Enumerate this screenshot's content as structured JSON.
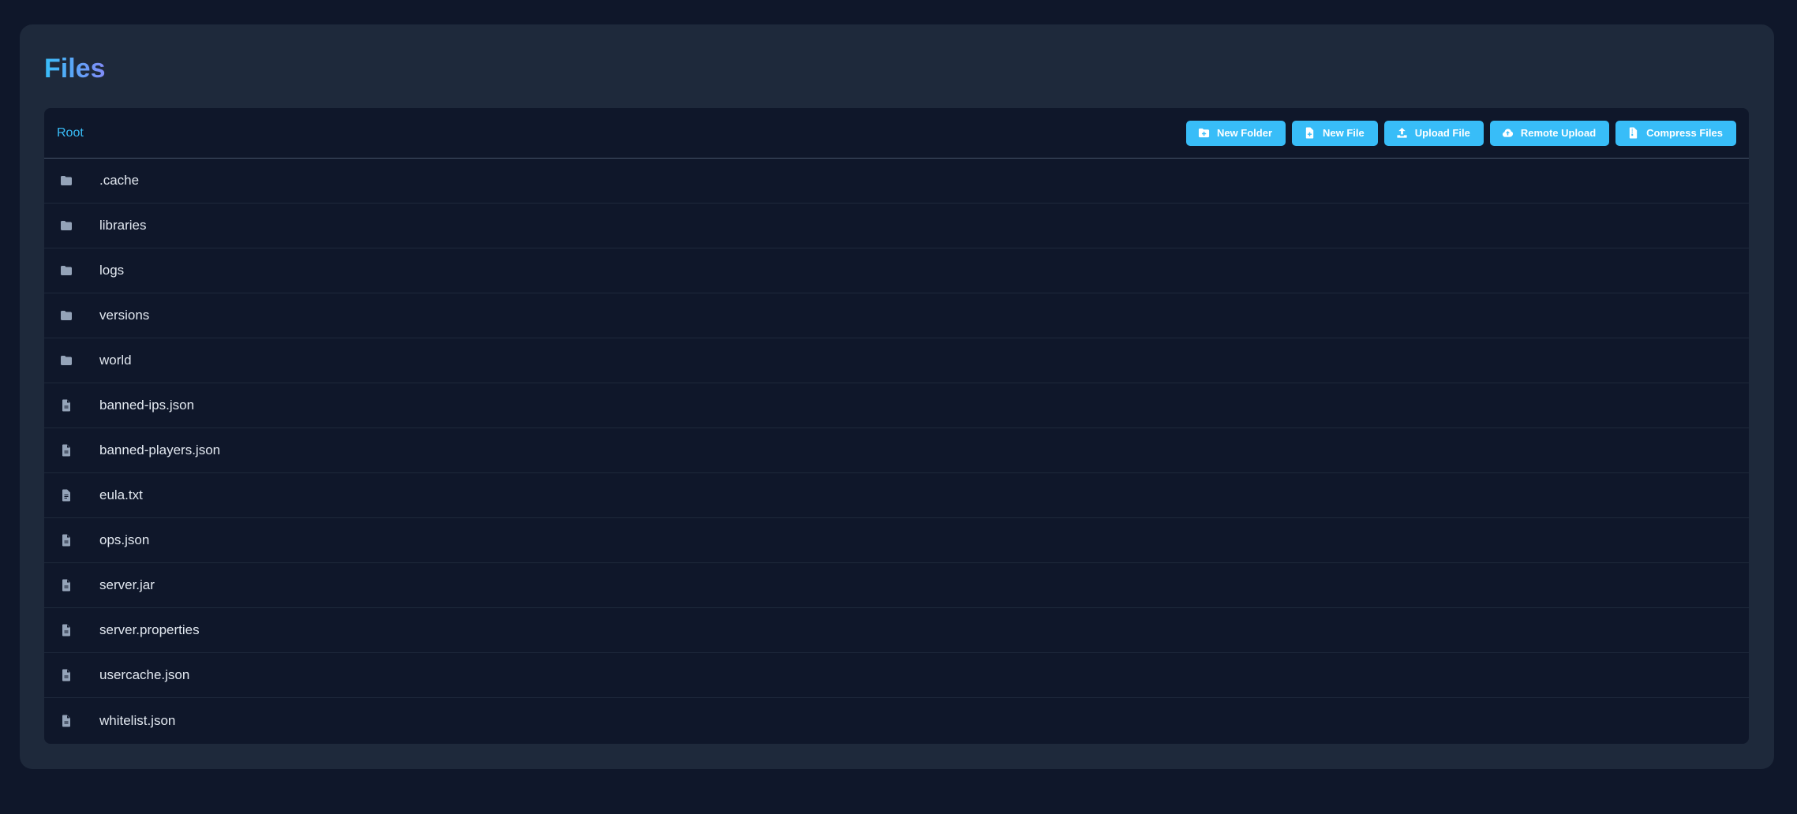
{
  "page": {
    "title": "Files"
  },
  "breadcrumb": {
    "root_label": "Root"
  },
  "toolbar": {
    "buttons": [
      {
        "label": "New Folder",
        "icon": "folder-plus-icon"
      },
      {
        "label": "New File",
        "icon": "file-plus-icon"
      },
      {
        "label": "Upload File",
        "icon": "upload-icon"
      },
      {
        "label": "Remote Upload",
        "icon": "cloud-upload-icon"
      },
      {
        "label": "Compress Files",
        "icon": "file-zipper-icon"
      }
    ]
  },
  "files": [
    {
      "name": ".cache",
      "type": "folder",
      "icon": "folder-icon"
    },
    {
      "name": "libraries",
      "type": "folder",
      "icon": "folder-icon"
    },
    {
      "name": "logs",
      "type": "folder",
      "icon": "folder-icon"
    },
    {
      "name": "versions",
      "type": "folder",
      "icon": "folder-icon"
    },
    {
      "name": "world",
      "type": "folder",
      "icon": "folder-icon"
    },
    {
      "name": "banned-ips.json",
      "type": "file",
      "icon": "file-icon"
    },
    {
      "name": "banned-players.json",
      "type": "file",
      "icon": "file-icon"
    },
    {
      "name": "eula.txt",
      "type": "file",
      "icon": "file-text-icon"
    },
    {
      "name": "ops.json",
      "type": "file",
      "icon": "file-icon"
    },
    {
      "name": "server.jar",
      "type": "file",
      "icon": "file-icon"
    },
    {
      "name": "server.properties",
      "type": "file",
      "icon": "file-icon"
    },
    {
      "name": "usercache.json",
      "type": "file",
      "icon": "file-icon"
    },
    {
      "name": "whitelist.json",
      "type": "file",
      "icon": "file-icon"
    }
  ],
  "colors": {
    "background": "#0f172a",
    "panel": "#1e293b",
    "accent": "#38bdf8",
    "icon": "#94a3b8",
    "text": "#e2e8f0"
  }
}
